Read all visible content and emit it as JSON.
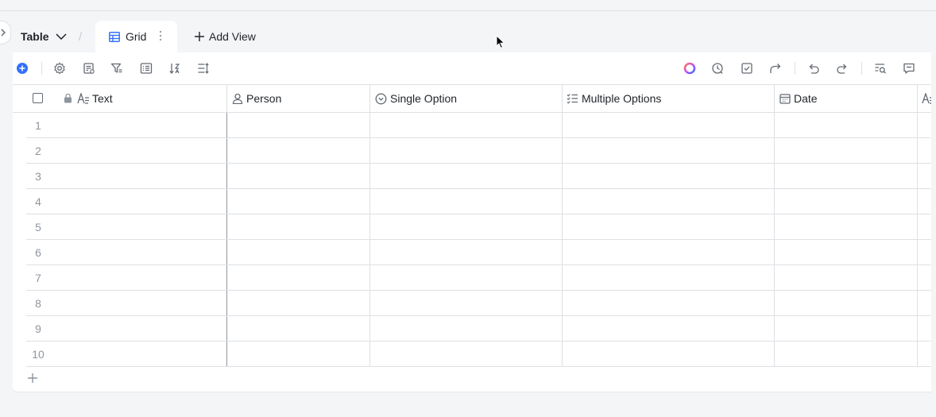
{
  "tabs": {
    "table_label": "Table",
    "separator": "/",
    "active_view_label": "Grid",
    "add_view_label": "Add View"
  },
  "toolbar": {
    "left_icons": [
      "add-record-icon",
      "settings-icon",
      "form-icon",
      "filter-icon",
      "group-icon",
      "sort-icon",
      "row-height-icon"
    ],
    "right_icons": [
      "ai-assistant-icon",
      "history-icon",
      "task-icon",
      "share-icon",
      "undo-icon",
      "redo-icon",
      "search-icon",
      "comment-icon"
    ]
  },
  "columns": [
    {
      "label": "Text",
      "icon": "text-field-icon",
      "locked": true
    },
    {
      "label": "Person",
      "icon": "person-field-icon"
    },
    {
      "label": "Single Option",
      "icon": "single-option-field-icon"
    },
    {
      "label": "Multiple Options",
      "icon": "multiple-options-field-icon"
    },
    {
      "label": "Date",
      "icon": "date-field-icon"
    },
    {
      "label": "",
      "icon": "text-field-icon"
    }
  ],
  "rows": [
    "1",
    "2",
    "3",
    "4",
    "5",
    "6",
    "7",
    "8",
    "9",
    "10"
  ],
  "colors": {
    "accent": "#3370ff",
    "border": "#dee0e3",
    "muted_text": "#8f959e",
    "background": "#f4f5f7"
  }
}
